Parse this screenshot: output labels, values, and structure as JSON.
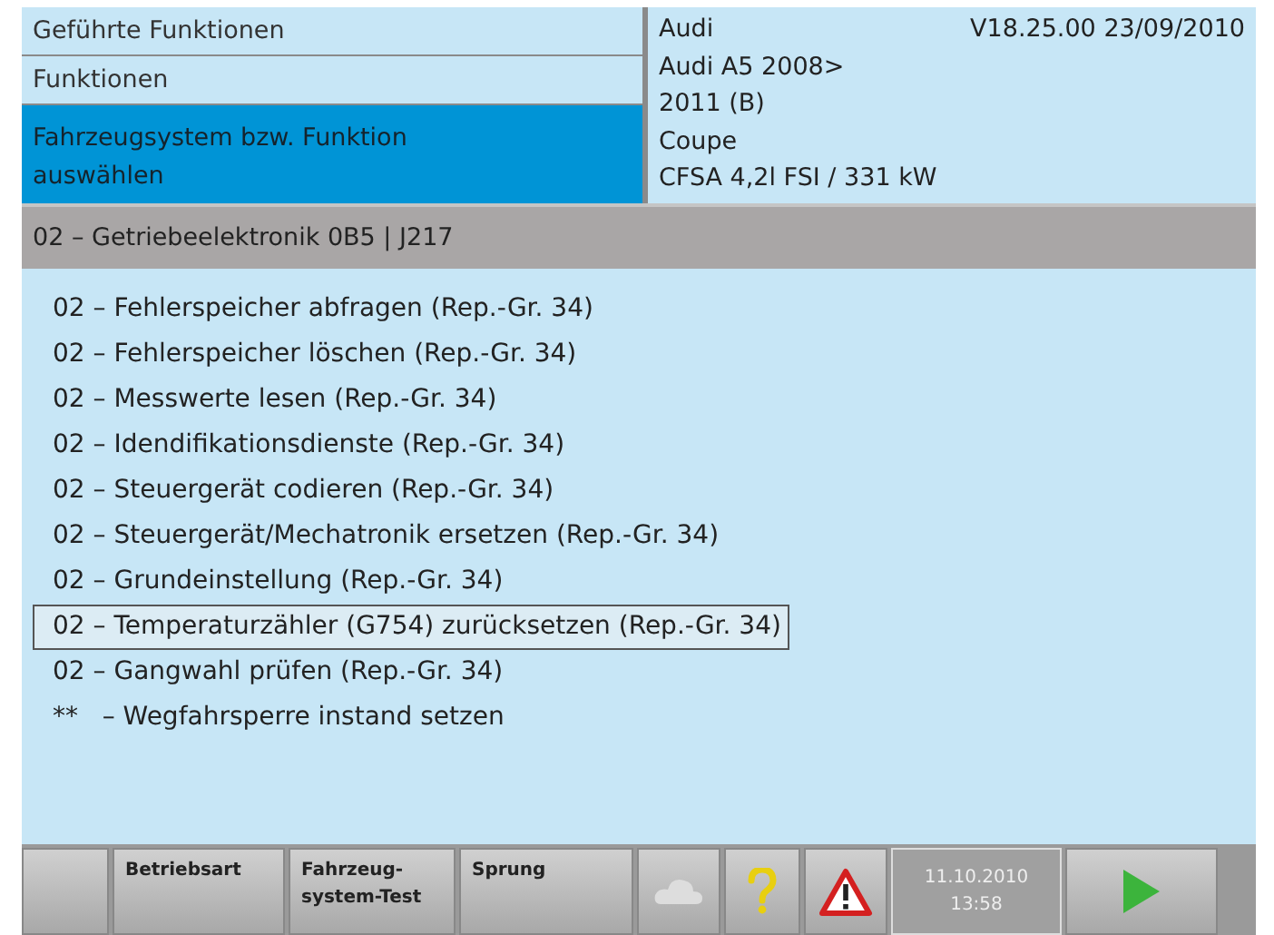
{
  "breadcrumbs": [
    {
      "label": "Geführte Funktionen",
      "selected": false
    },
    {
      "label": "Funktionen",
      "selected": false
    },
    {
      "label": "Fahrzeugsystem bzw. Funktion auswählen",
      "selected": true
    }
  ],
  "vehicle": {
    "make": "Audi",
    "version": "V18.25.00 23/09/2010",
    "lines": [
      "Audi A5 2008>",
      "2011 (B)",
      "Coupe",
      "CFSA 4,2l FSI / 331 kW"
    ]
  },
  "system_bar": "02 – Getriebeelektronik 0B5 | J217",
  "functions": [
    {
      "label": "02 – Fehlerspeicher abfragen (Rep.-Gr. 34)",
      "selected": false
    },
    {
      "label": "02 – Fehlerspeicher löschen (Rep.-Gr. 34)",
      "selected": false
    },
    {
      "label": "02 – Messwerte lesen (Rep.-Gr. 34)",
      "selected": false
    },
    {
      "label": "02 – Idendifikationsdienste (Rep.-Gr. 34)",
      "selected": false
    },
    {
      "label": "02 – Steuergerät codieren (Rep.-Gr. 34)",
      "selected": false
    },
    {
      "label": "02 – Steuergerät/Mechatronik ersetzen (Rep.-Gr. 34)",
      "selected": false
    },
    {
      "label": "02 – Grundeinstellung (Rep.-Gr. 34)",
      "selected": false
    },
    {
      "label": "02 – Temperaturzähler (G754) zurücksetzen (Rep.-Gr. 34)",
      "selected": true
    },
    {
      "label": "02 – Gangwahl prüfen (Rep.-Gr. 34)",
      "selected": false
    },
    {
      "label": "**   – Wegfahrsperre instand setzen",
      "selected": false
    }
  ],
  "toolbar": [
    {
      "kind": "blank"
    },
    {
      "kind": "text",
      "label": "Betriebsart"
    },
    {
      "kind": "text",
      "label": "Fahrzeug-\nsystem-Test"
    },
    {
      "kind": "text",
      "label": "Sprung"
    },
    {
      "kind": "cloud",
      "disabled": true
    },
    {
      "kind": "help"
    },
    {
      "kind": "warning"
    },
    {
      "kind": "clock",
      "date": "11.10.2010",
      "time": "13:58"
    },
    {
      "kind": "play"
    }
  ]
}
